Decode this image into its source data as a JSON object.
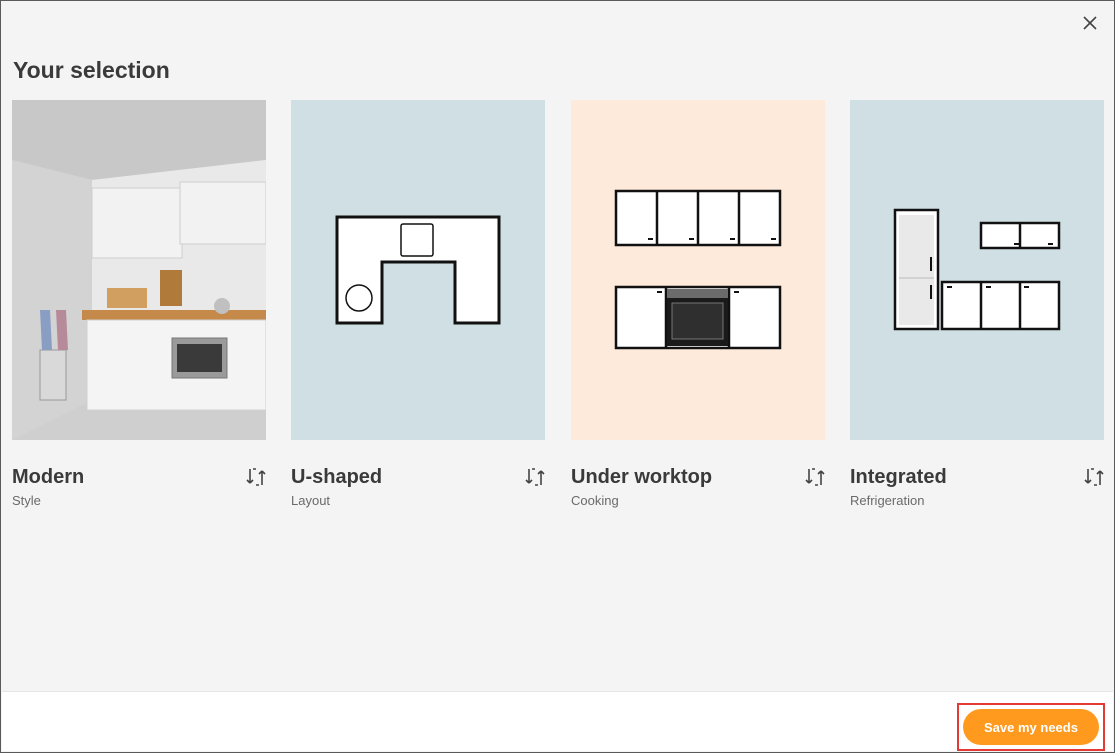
{
  "dialog": {
    "title": "Your selection",
    "close_icon": "close-icon"
  },
  "cards": [
    {
      "name": "Modern",
      "sub": "Style",
      "bg": "#e6e6e6",
      "icon": "swap-icon"
    },
    {
      "name": "U-shaped",
      "sub": "Layout",
      "bg": "#cfdfe3",
      "icon": "swap-icon"
    },
    {
      "name": "Under worktop",
      "sub": "Cooking",
      "bg": "#fdeadb",
      "icon": "swap-icon"
    },
    {
      "name": "Integrated",
      "sub": "Refrigeration",
      "bg": "#cfdfe3",
      "icon": "swap-icon"
    }
  ],
  "footer": {
    "save_label": "Save my needs",
    "accent": "#ff9a1f",
    "highlight": "#e53935"
  }
}
